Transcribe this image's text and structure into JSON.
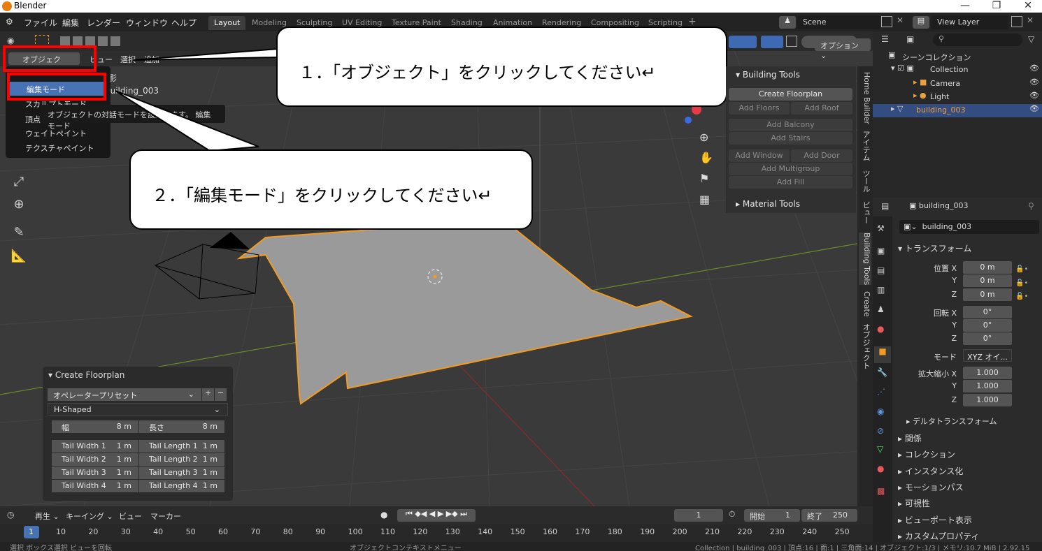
{
  "window": {
    "title": "Blender",
    "minimize": "—",
    "maximize": "❐",
    "close": "✕"
  },
  "menu": {
    "items": [
      "ファイル",
      "編集",
      "レンダー",
      "ウィンドウ",
      "ヘルプ"
    ],
    "workspaces": [
      "Layout",
      "Modeling",
      "Sculpting",
      "UV Editing",
      "Texture Paint",
      "Shading",
      "Animation",
      "Rendering",
      "Compositing",
      "Scripting"
    ],
    "add_tab": "+",
    "scene": "Scene",
    "view_layer": "View Layer"
  },
  "viewport": {
    "mode_button": "オブジェクト...",
    "header_items": [
      "ビュー",
      "選択",
      "追加"
    ],
    "options": "オプション ⌄",
    "object_name": "building_003",
    "partial_label": "影"
  },
  "mode_menu": {
    "items": [
      "編集モード",
      "スカルプトモード",
      "頂点ペイント",
      "ウェイトペイント",
      "テクスチャペイント"
    ],
    "selected_index": 0,
    "tooltip": "オブジェクトの対話モードを設定します。 編集モード"
  },
  "callouts": {
    "step1": "１．「オブジェクト」をクリックしてください↵",
    "step2": "２．「編集モード」をクリックしてください↵"
  },
  "npanel": {
    "building_tools": "Building Tools",
    "create_floorplan": "Create Floorplan",
    "add_floors": "Add Floors",
    "add_roof": "Add Roof",
    "add_balcony": "Add Balcony",
    "add_stairs": "Add Stairs",
    "add_window": "Add Window",
    "add_door": "Add Door",
    "add_multigroup": "Add Multigroup",
    "add_fill": "Add Fill",
    "material_tools": "Material Tools",
    "tabs": [
      "Home Builder",
      "アイテム",
      "ツール",
      "ビュー",
      "Building Tools",
      "Create",
      "オブジェクト"
    ]
  },
  "redo_panel": {
    "title": "Create Floorplan",
    "preset": "オペレータープリセット",
    "plus": "+",
    "minus": "−",
    "shape": "H-Shaped",
    "width_label": "幅",
    "width_value": "8 m",
    "length_label": "長さ",
    "length_value": "8 m",
    "tails": [
      {
        "wl": "Tail Width 1",
        "wv": "1 m",
        "ll": "Tail Length 1",
        "lv": "1 m"
      },
      {
        "wl": "Tail Width 2",
        "wv": "1 m",
        "ll": "Tail Length 2",
        "lv": "1 m"
      },
      {
        "wl": "Tail Width 3",
        "wv": "1 m",
        "ll": "Tail Length 3",
        "lv": "1 m"
      },
      {
        "wl": "Tail Width 4",
        "wv": "1 m",
        "ll": "Tail Length 4",
        "lv": "1 m"
      }
    ]
  },
  "outliner": {
    "root": "シーンコレクション",
    "collection": "Collection",
    "camera": "Camera",
    "light": "Light",
    "building": "building_003"
  },
  "properties": {
    "header_object": "building_003",
    "object_name": "building_003",
    "transform": "トランスフォーム",
    "location_label": "位置 X",
    "y": "Y",
    "z": "Z",
    "location": [
      "0 m",
      "0 m",
      "0 m"
    ],
    "rotation_label": "回転 X",
    "rotation": [
      "0°",
      "0°",
      "0°"
    ],
    "mode_label": "モード",
    "mode_value": "XYZ オイ...",
    "scale_label": "拡大縮小 X",
    "scale": [
      "1.000",
      "1.000",
      "1.000"
    ],
    "delta": "デルタトランスフォーム",
    "sections": [
      "関係",
      "コレクション",
      "インスタンス化",
      "モーションパス",
      "可視性",
      "ビューポート表示",
      "カスタムプロパティ"
    ]
  },
  "timeline": {
    "playback": "再生 ⌄",
    "keying": "キーイング ⌄",
    "view": "ビュー",
    "marker": "マーカー",
    "current_frame": "1",
    "start_label": "開始",
    "start": "1",
    "end_label": "終了",
    "end": "250",
    "ticks": [
      "1",
      "10",
      "20",
      "30",
      "40",
      "50",
      "60",
      "70",
      "80",
      "90",
      "100",
      "110",
      "120",
      "130",
      "140",
      "150",
      "160",
      "170",
      "180",
      "190",
      "200",
      "210",
      "220",
      "230",
      "240",
      "250"
    ]
  },
  "statusbar": {
    "left": "選択      ボックス選択           ビューを回転",
    "mid": "オブジェクトコンテキストメニュー",
    "right": "Collection | building_003 | 頂点:16 | 面:1 | 三角面:14 | オブジェクト:1/3 | メモリ:10.7 MiB | 2.92.15"
  }
}
